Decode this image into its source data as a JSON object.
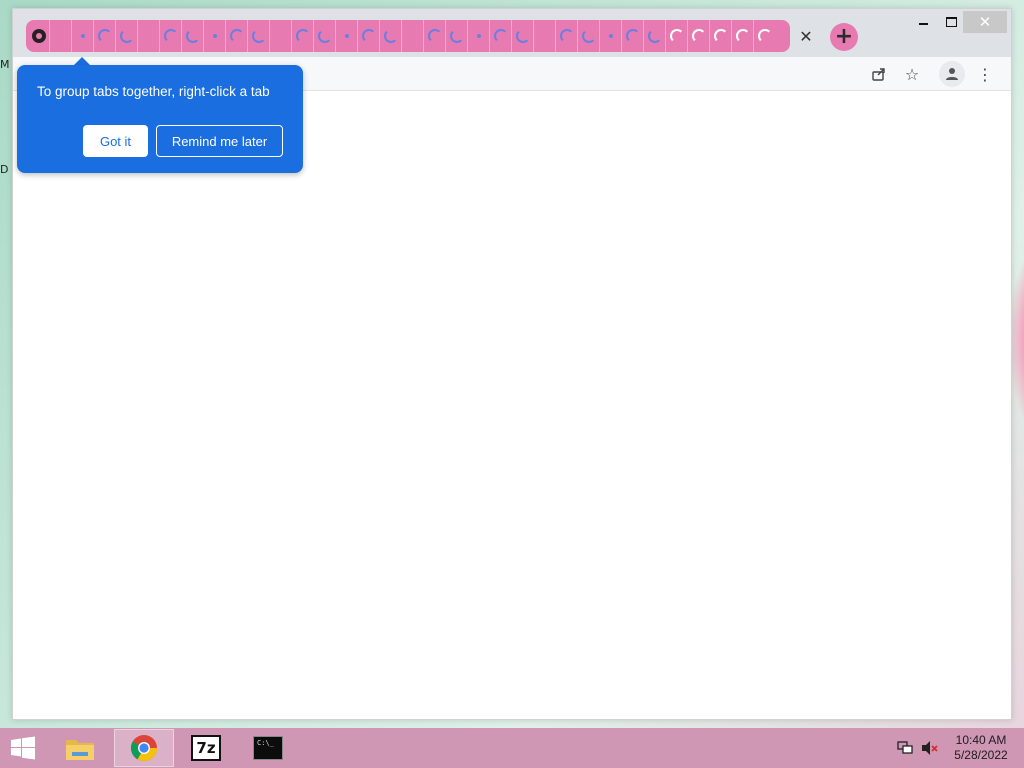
{
  "desktop": {
    "edge_labels": [
      "M",
      "D"
    ]
  },
  "browser": {
    "tabs": [
      {
        "icon": "github-icon"
      },
      {
        "icon": "blank-icon"
      },
      {
        "icon": "loading-spinner-icon"
      },
      {
        "icon": "loading-spinner-icon"
      },
      {
        "icon": "loading-spinner-icon"
      },
      {
        "icon": "loading-spinner-icon"
      },
      {
        "icon": "loading-spinner-icon"
      },
      {
        "icon": "loading-spinner-icon"
      },
      {
        "icon": "loading-spinner-icon"
      },
      {
        "icon": "loading-spinner-icon"
      },
      {
        "icon": "loading-spinner-icon"
      },
      {
        "icon": "loading-spinner-icon"
      },
      {
        "icon": "loading-spinner-icon"
      },
      {
        "icon": "loading-spinner-icon"
      },
      {
        "icon": "loading-spinner-icon"
      },
      {
        "icon": "loading-spinner-icon"
      },
      {
        "icon": "loading-spinner-icon"
      },
      {
        "icon": "loading-spinner-icon"
      },
      {
        "icon": "loading-spinner-icon"
      },
      {
        "icon": "loading-spinner-icon"
      },
      {
        "icon": "loading-spinner-icon"
      },
      {
        "icon": "loading-spinner-icon"
      },
      {
        "icon": "loading-spinner-icon"
      },
      {
        "icon": "loading-spinner-icon"
      },
      {
        "icon": "loading-spinner-icon"
      },
      {
        "icon": "loading-spinner-icon"
      },
      {
        "icon": "loading-spinner-icon"
      },
      {
        "icon": "loading-spinner-icon"
      },
      {
        "icon": "loading-spinner-icon"
      },
      {
        "icon": "loading-spinner-icon"
      },
      {
        "icon": "loading-spinner-icon"
      },
      {
        "icon": "loading-spinner-icon"
      },
      {
        "icon": "loading-spinner-icon"
      },
      {
        "icon": "loading-spinner-icon"
      }
    ],
    "tab_close_glyph": "✕",
    "new_tab_glyph": "+",
    "window_controls": {
      "close_glyph": "✕"
    },
    "toolbar": {
      "share_icon": "share-icon",
      "bookmark_glyph": "☆",
      "profile_icon": "profile-icon",
      "menu_glyph": "⋮"
    },
    "colors": {
      "tab_group": "#e87ab2",
      "promo_bubble": "#1a6ee0",
      "spinner": "#6b7fe0"
    }
  },
  "promo": {
    "message": "To group tabs together, right-click a tab",
    "got_it_label": "Got it",
    "remind_label": "Remind me later"
  },
  "taskbar": {
    "apps": [
      "file-explorer",
      "google-chrome",
      "7-zip",
      "command-prompt"
    ],
    "seven_zip_label": "7z",
    "cmd_label": "C:\\_",
    "clock_time": "10:40 AM",
    "clock_date": "5/28/2022",
    "colors": {
      "bar": "#cf97b4"
    }
  }
}
